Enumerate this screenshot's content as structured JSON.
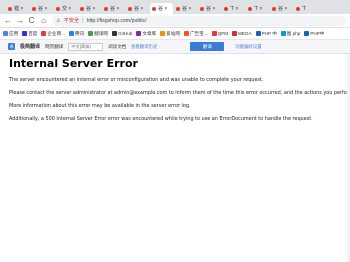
{
  "tabs": [
    {
      "label": "错 ×",
      "active": false
    },
    {
      "label": "谷 ×",
      "active": false
    },
    {
      "label": "交 ×",
      "active": false
    },
    {
      "label": "谷 ×",
      "active": false
    },
    {
      "label": "谷 ×",
      "active": false
    },
    {
      "label": "谷 ×",
      "active": false
    },
    {
      "label": "谷 ×",
      "active": true
    },
    {
      "label": "谷 ×",
      "active": false
    },
    {
      "label": "谷 ×",
      "active": false
    },
    {
      "label": "ʻT ×",
      "active": false
    },
    {
      "label": "ʻT ×",
      "active": false
    },
    {
      "label": "谷 ×",
      "active": false
    },
    {
      "label": "ʻT",
      "active": false
    }
  ],
  "nav": {
    "back": "←",
    "forward": "→",
    "reload": "C",
    "home": "⌂",
    "warning": "⚠",
    "security_label": "不安全",
    "separator": "|",
    "url": "http://fisgshop.com/public/"
  },
  "bookmarks": [
    {
      "label": "应用",
      "color": "#4285f4"
    },
    {
      "label": "百度",
      "color": "#2932e1"
    },
    {
      "label": "企业网...",
      "color": "#e53935"
    },
    {
      "label": "腾讯",
      "color": "#1e88e5"
    },
    {
      "label": "翻译网",
      "color": "#43a047"
    },
    {
      "label": "GitHub",
      "color": "#333333"
    },
    {
      "label": "文章库",
      "color": "#8e24aa"
    },
    {
      "label": "爱站网",
      "color": "#fb8c00"
    },
    {
      "label": "广告宝...",
      "color": "#f4511e"
    },
    {
      "label": "QPM",
      "color": "#e53935"
    },
    {
      "label": "MEGA",
      "color": "#d32f2f"
    },
    {
      "label": "PHP 中",
      "color": "#1565c0"
    },
    {
      "label": "图 php",
      "color": "#039be5"
    },
    {
      "label": "PHP中",
      "color": "#1565c0"
    }
  ],
  "translate_bar": {
    "logo": "译",
    "title": "极简翻译",
    "full_page_label": "网页翻译",
    "select_placeholder": "中文(简体)",
    "link1": "阅读文档",
    "link2": "查看翻译历史",
    "button_label": "翻译",
    "settings_label": "功能偏好设置"
  },
  "page": {
    "title": "Internal Server Error",
    "paragraphs": [
      "The server encountered an internal error or misconfiguration and was unable to complete your request.",
      "Please contact the server administrator at admin@example.com to inform them of the time this error occurred, and the actions you perform",
      "More information about this error may be available in the server error log.",
      "Additionally, a 500 Internal Server Error error was encountered while trying to use an ErrorDocument to handle the request."
    ]
  }
}
